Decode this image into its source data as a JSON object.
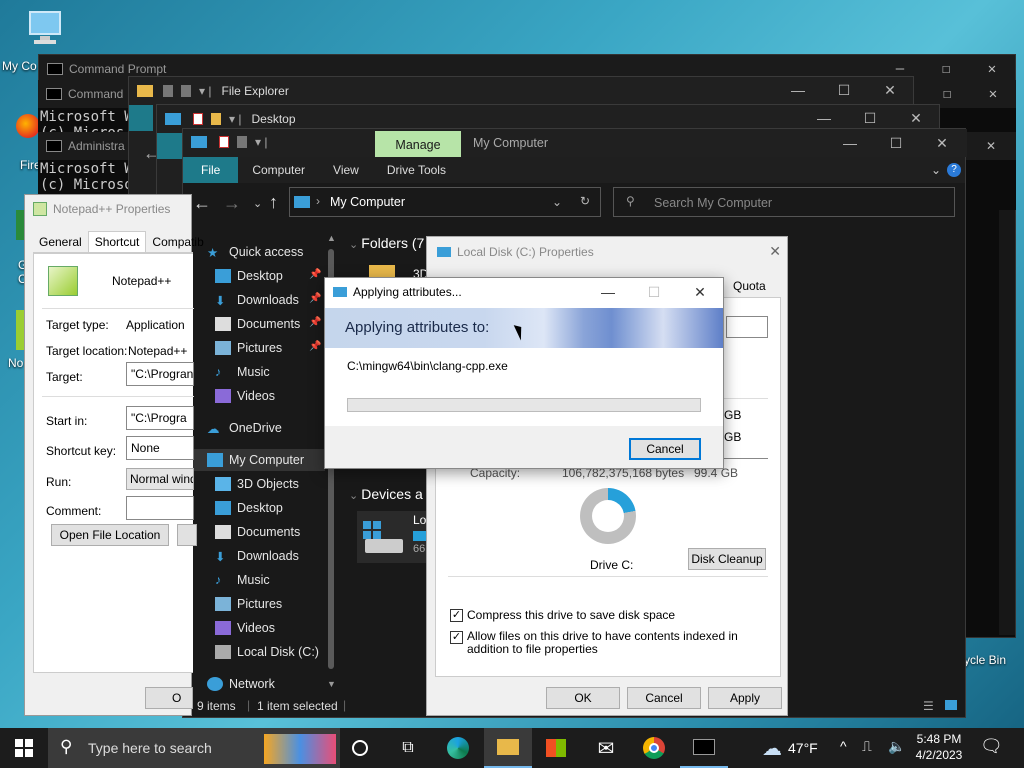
{
  "desktop": {
    "icons": [
      {
        "label": "My Co"
      },
      {
        "label": "Fire"
      },
      {
        "label": "G\nC"
      },
      {
        "label": "No"
      }
    ],
    "recycle_label": "ycle Bin"
  },
  "cmd_windows": [
    {
      "title": "Command Prompt"
    },
    {
      "title": "Command"
    },
    {
      "title": "Administra"
    }
  ],
  "cmd_text": [
    "Microsoft Wi",
    "(c) Micros",
    "Microsoft Wi",
    "(c) Microso"
  ],
  "file_explorer_back": {
    "title": "File Explorer"
  },
  "desktop_window": {
    "title": "Desktop"
  },
  "explorer": {
    "manage_tab": "Manage",
    "title": "My Computer",
    "ribbon_tabs": [
      "File",
      "Computer",
      "View",
      "Drive Tools"
    ],
    "address": "My Computer",
    "search_placeholder": "Search My Computer",
    "nav_quick": "Quick access",
    "nav_items": [
      {
        "label": "Desktop",
        "pinned": true
      },
      {
        "label": "Downloads",
        "pinned": true
      },
      {
        "label": "Documents",
        "pinned": true
      },
      {
        "label": "Pictures",
        "pinned": true
      },
      {
        "label": "Music",
        "pinned": false
      },
      {
        "label": "Videos",
        "pinned": false
      }
    ],
    "nav_onedrive": "OneDrive",
    "nav_mycomputer": "My Computer",
    "nav_mycomputer_items": [
      "3D Objects",
      "Desktop",
      "Documents",
      "Downloads",
      "Music",
      "Pictures",
      "Videos",
      "Local Disk (C:)"
    ],
    "nav_network": "Network",
    "folders_header": "Folders (7",
    "folder_item": "3D",
    "devices_header": "Devices a",
    "device_label": "Lo",
    "device_sub": "66.",
    "status_items": "9 items",
    "status_selected": "1 item selected"
  },
  "notepad_props": {
    "title": "Notepad++ Properties",
    "tabs": [
      "General",
      "Shortcut",
      "Compatib"
    ],
    "name": "Notepad++",
    "target_type_label": "Target type:",
    "target_type": "Application",
    "target_location_label": "Target location:",
    "target_location": "Notepad++",
    "target_label": "Target:",
    "target_value": "\"C:\\Progran",
    "startin_label": "Start in:",
    "startin_value": "\"C:\\Progra",
    "shortcut_label": "Shortcut key:",
    "shortcut_value": "None",
    "run_label": "Run:",
    "run_value": "Normal wind",
    "comment_label": "Comment:",
    "open_location": "Open File Location",
    "ok_partial": "O"
  },
  "disk_props": {
    "title": "Local Disk (C:) Properties",
    "quota_tab": "Quota",
    "capacity_label": "Capacity:",
    "capacity_bytes": "106,782,375,168 bytes",
    "capacity_gb": "99.4 GB",
    "gb1": "GB",
    "gb2": "GB",
    "drive_label": "Drive C:",
    "cleanup": "Disk Cleanup",
    "compress": "Compress this drive to save disk space",
    "index": "Allow files on this drive to have contents indexed in addition to file properties",
    "ok": "OK",
    "cancel": "Cancel",
    "apply": "Apply"
  },
  "applying": {
    "title": "Applying attributes...",
    "header": "Applying attributes to:",
    "path": "C:\\mingw64\\bin\\clang-cpp.exe",
    "progress": 0,
    "cancel": "Cancel"
  },
  "taskbar": {
    "search_placeholder": "Type here to search",
    "weather": "47°F",
    "time": "5:48 PM",
    "date": "4/2/2023"
  },
  "colors": {
    "accent": "#0078d7",
    "manage_tab": "#b7e4a8",
    "ribbon_file": "#1e7a8a"
  }
}
